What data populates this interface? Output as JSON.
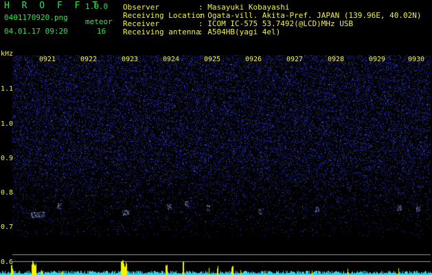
{
  "app": {
    "name": "H R O F F T",
    "version": "1.0.0"
  },
  "file": {
    "name": "0401170920.png",
    "datetime": "04.01.17 09:20"
  },
  "meteor": {
    "label": "meteor",
    "count": "16"
  },
  "station": {
    "observer_label": "Observer",
    "observer_value": ": Masayuki Kobayashi",
    "location_label": "Receiving Location",
    "location_value": ": Ogata-vill. Akita-Pref. JAPAN (139.96E, 40.02N)",
    "receiver_label": "Receiver",
    "receiver_value": ": ICOM IC-575 53.7492(@LCD)MHz USB",
    "antenna_label": "Receiving antenna",
    "antenna_value": ": A504HB(yagi 4el)"
  },
  "axis": {
    "unit": "kHz",
    "freq_ticks": [
      "1.1",
      "1.0",
      "0.9",
      "0.8",
      "0.7",
      "0.6"
    ],
    "time_ticks": [
      "0921",
      "0922",
      "0923",
      "0924",
      "0925",
      "0926",
      "0927",
      "0928",
      "0929",
      "0930"
    ]
  },
  "colors": {
    "background": "#000000",
    "noise": "#2a38c8",
    "header_green": "#2ee64a",
    "label_yellow": "#f2f24a",
    "level_cyan": "#30d8e8"
  }
}
